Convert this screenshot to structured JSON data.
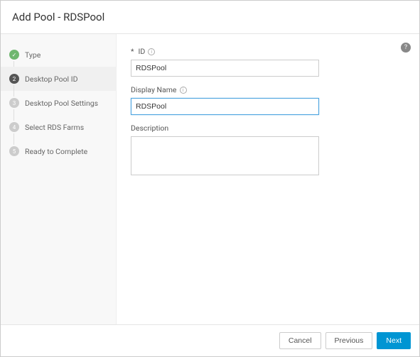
{
  "header": {
    "title": "Add Pool - RDSPool"
  },
  "sidebar": {
    "steps": [
      {
        "label": "Type",
        "num": "",
        "status": "completed"
      },
      {
        "label": "Desktop Pool ID",
        "num": "2",
        "status": "current"
      },
      {
        "label": "Desktop Pool Settings",
        "num": "3",
        "status": "pending"
      },
      {
        "label": "Select RDS Farms",
        "num": "4",
        "status": "pending"
      },
      {
        "label": "Ready to Complete",
        "num": "5",
        "status": "pending"
      }
    ]
  },
  "form": {
    "id_label": "ID",
    "id_value": "RDSPool",
    "display_name_label": "Display Name",
    "display_name_value": "RDSPool",
    "description_label": "Description",
    "description_value": ""
  },
  "footer": {
    "cancel": "Cancel",
    "previous": "Previous",
    "next": "Next"
  },
  "help_tooltip": "?"
}
